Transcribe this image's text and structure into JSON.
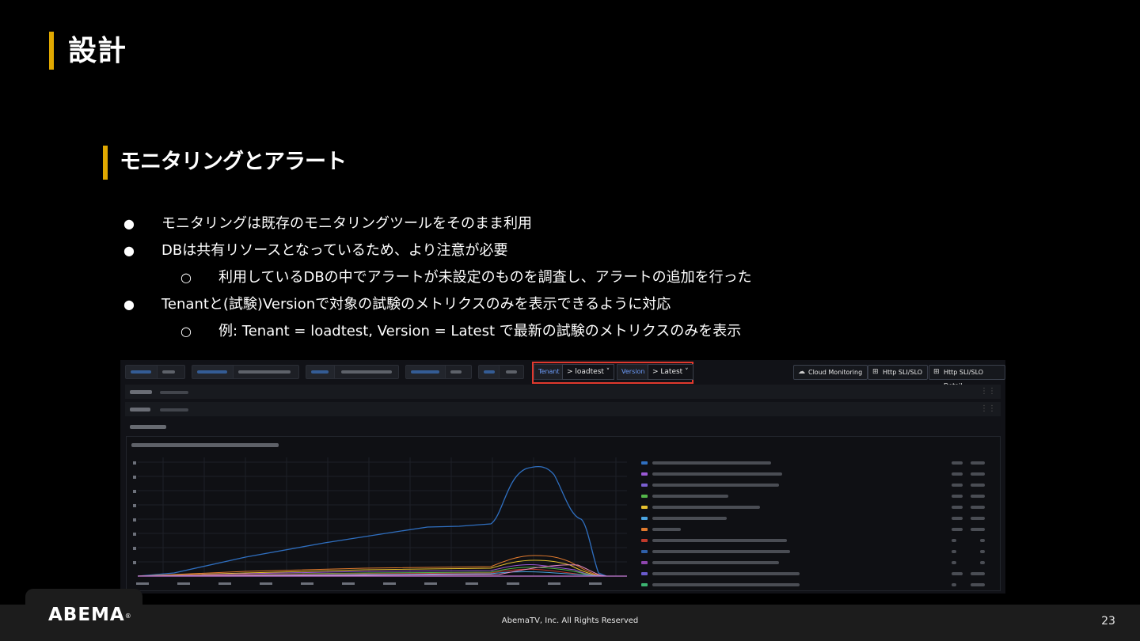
{
  "slide": {
    "title": "設計",
    "subtitle": "モニタリングとアラート",
    "bullets": [
      {
        "marker": "●",
        "text": "モニタリングは既存のモニタリングツールをそのまま利用"
      },
      {
        "marker": "●",
        "text": "DBは共有リソースとなっているため、より注意が必要"
      },
      {
        "marker": "○",
        "text": "利用しているDBの中でアラートが未設定のものを調査し、アラートの追加を行った"
      },
      {
        "marker": "●",
        "text": "Tenantと(試験)Versionで対象の試験のメトリクスのみを表示できるように対応"
      },
      {
        "marker": "○",
        "text": "例: Tenant = loadtest, Version = Latest で最新の試験のメトリクスのみを表示"
      }
    ]
  },
  "dashboard": {
    "tenant_label": "Tenant",
    "tenant_value": "> loadtest ˅",
    "version_label": "Version",
    "version_value": "> Latest ˅",
    "buttons": [
      {
        "label": "Cloud Monitoring",
        "icon": "cloud-icon"
      },
      {
        "label": "Http SLI/SLO",
        "icon": "dashboard-grid-icon"
      },
      {
        "label": "Http SLI/SLO Detail",
        "icon": "dashboard-grid-icon"
      }
    ],
    "series_colors": [
      "#2f6fc0",
      "#9b59d6",
      "#7a5fd1",
      "#53b64a",
      "#e6c02e",
      "#4aa3df",
      "#e07a2e",
      "#c0392b",
      "#2f5fa8",
      "#8e44ad",
      "#6a5acd",
      "#3cb371"
    ]
  },
  "footer": {
    "logo": "ABEMA",
    "logo_mark": "®",
    "copyright": "AbemaTV, Inc. All Rights Reserved",
    "page_number": "23"
  }
}
